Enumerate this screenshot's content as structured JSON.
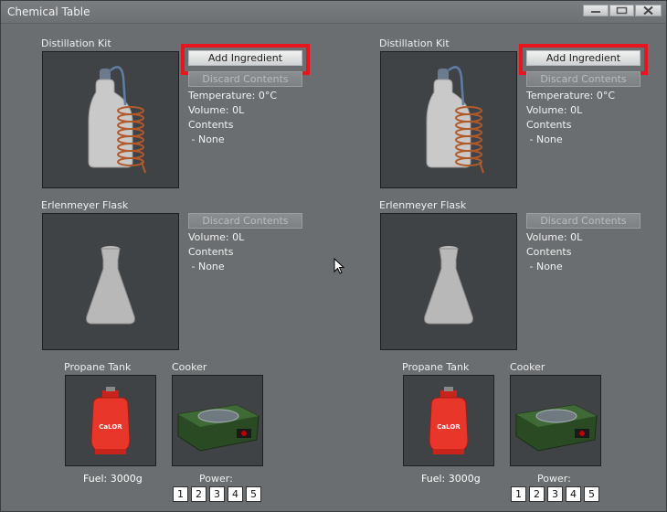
{
  "window": {
    "title": "Chemical Table",
    "controls": [
      "minimize-icon",
      "maximize-icon",
      "close-icon"
    ]
  },
  "stations": [
    {
      "distillation": {
        "label": "Distillation Kit",
        "add_label": "Add Ingredient",
        "discard_label": "Discard Contents",
        "temperature": "Temperature: 0°C",
        "volume": "Volume: 0L",
        "contents_label": "Contents",
        "contents_value": " - None"
      },
      "flask": {
        "label": "Erlenmeyer Flask",
        "discard_label": "Discard Contents",
        "volume": "Volume: 0L",
        "contents_label": "Contents",
        "contents_value": " - None"
      },
      "propane": {
        "label": "Propane Tank",
        "fuel": "Fuel: 3000g"
      },
      "cooker": {
        "label": "Cooker",
        "power_label": "Power:",
        "power_levels": [
          "1",
          "2",
          "3",
          "4",
          "5"
        ]
      }
    },
    {
      "distillation": {
        "label": "Distillation Kit",
        "add_label": "Add Ingredient",
        "discard_label": "Discard Contents",
        "temperature": "Temperature: 0°C",
        "volume": "Volume: 0L",
        "contents_label": "Contents",
        "contents_value": " - None"
      },
      "flask": {
        "label": "Erlenmeyer Flask",
        "discard_label": "Discard Contents",
        "volume": "Volume: 0L",
        "contents_label": "Contents",
        "contents_value": " - None"
      },
      "propane": {
        "label": "Propane Tank",
        "fuel": "Fuel: 3000g"
      },
      "cooker": {
        "label": "Cooker",
        "power_label": "Power:",
        "power_levels": [
          "1",
          "2",
          "3",
          "4",
          "5"
        ]
      }
    }
  ],
  "colors": {
    "highlight": "#e8141e",
    "panel_bg": "#6a6e71",
    "image_bg": "#404346"
  }
}
